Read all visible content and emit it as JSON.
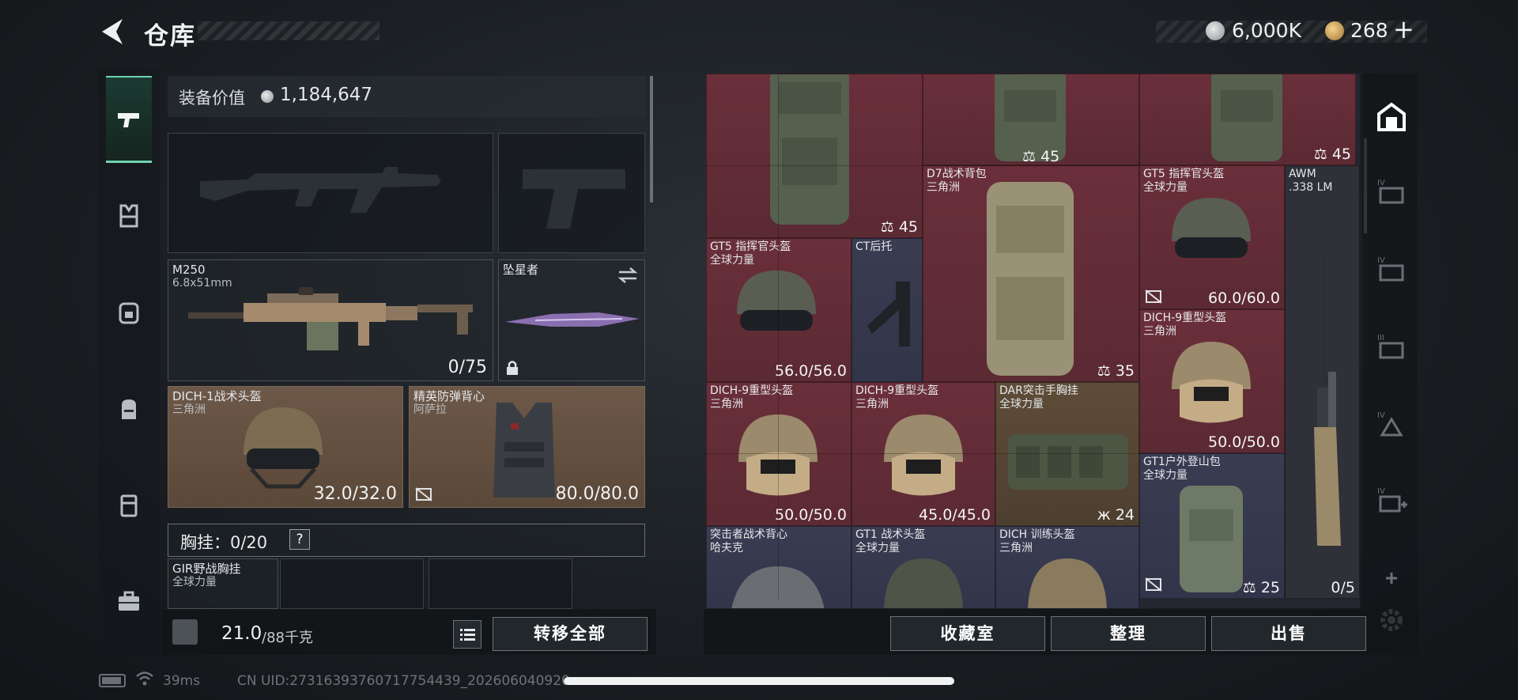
{
  "header": {
    "title": "仓库",
    "silver_value": "6,000K",
    "gold_value": "268",
    "gold_plus": "+"
  },
  "sidebar": {
    "items": [
      {
        "name": "weapons",
        "icon": "pistol-icon",
        "active": true
      },
      {
        "name": "vest",
        "icon": "vest-icon"
      },
      {
        "name": "helmet",
        "icon": "helmet-icon"
      },
      {
        "name": "backpack",
        "icon": "backpack-icon"
      },
      {
        "name": "armor",
        "icon": "armor-icon"
      },
      {
        "name": "case",
        "icon": "briefcase-icon"
      }
    ]
  },
  "loadout": {
    "equip_value_label": "装备价值",
    "equip_value": "1,184,647",
    "primary": {
      "name": "M250",
      "caliber": "6.8x51mm",
      "ammo": "0/75"
    },
    "melee": {
      "name": "坠星者"
    },
    "helmet": {
      "name": "DICH-1战术头盔",
      "origin": "三角洲",
      "durability": "32.0/32.0"
    },
    "armor": {
      "name": "精英防弹背心",
      "origin": "阿萨拉",
      "durability": "80.0/80.0"
    },
    "chest_rig_label": "胸挂：",
    "chest_rig_count": "0/20",
    "chest_rig_help": "?",
    "chest_rig_item": {
      "name": "GIR野战胸挂",
      "origin": "全球力量"
    },
    "weight": "21.0",
    "weight_max": "/88千克",
    "transfer_all": "转移全部"
  },
  "grid": {
    "items": [
      {
        "name": "",
        "origin": "",
        "count": "45",
        "color": "red"
      },
      {
        "name": "",
        "origin": "",
        "count": "45",
        "color": "red"
      },
      {
        "name": "",
        "origin": "",
        "count": "45",
        "color": "red"
      },
      {
        "name": "D7战术背包",
        "origin": "三角洲",
        "count": "35",
        "color": "red"
      },
      {
        "name": "GT5 指挥官头盔",
        "origin": "全球力量",
        "durability": "60.0/60.0",
        "color": "red"
      },
      {
        "name": "AWM",
        "origin": ".338 LM",
        "count": "0/5",
        "color": "dark"
      },
      {
        "name": "GT5 指挥官头盔",
        "origin": "全球力量",
        "durability": "56.0/56.0",
        "color": "red"
      },
      {
        "name": "CT后托",
        "origin": "",
        "color": "blue"
      },
      {
        "name": "DICH-9重型头盔",
        "origin": "三角洲",
        "durability": "50.0/50.0",
        "color": "red"
      },
      {
        "name": "DICH-9重型头盔",
        "origin": "三角洲",
        "durability": "50.0/50.0",
        "color": "red"
      },
      {
        "name": "DICH-9重型头盔",
        "origin": "三角洲",
        "durability": "45.0/45.0",
        "color": "red"
      },
      {
        "name": "DAR突击手胸挂",
        "origin": "全球力量",
        "count": "24",
        "color": "gold"
      },
      {
        "name": "GT1户外登山包",
        "origin": "全球力量",
        "count": "25",
        "color": "blue"
      },
      {
        "name": "突击者战术背心",
        "origin": "哈夫克",
        "color": "blue"
      },
      {
        "name": "GT1 战术头盔",
        "origin": "全球力量",
        "color": "blue"
      },
      {
        "name": "DICH 训练头盔",
        "origin": "三角洲",
        "color": "blue"
      }
    ]
  },
  "actions": {
    "collection": "收藏室",
    "sort": "整理",
    "sell": "出售"
  },
  "status": {
    "ping": "39ms",
    "uid": "CN UID:27316393760717754439_202606040920"
  }
}
